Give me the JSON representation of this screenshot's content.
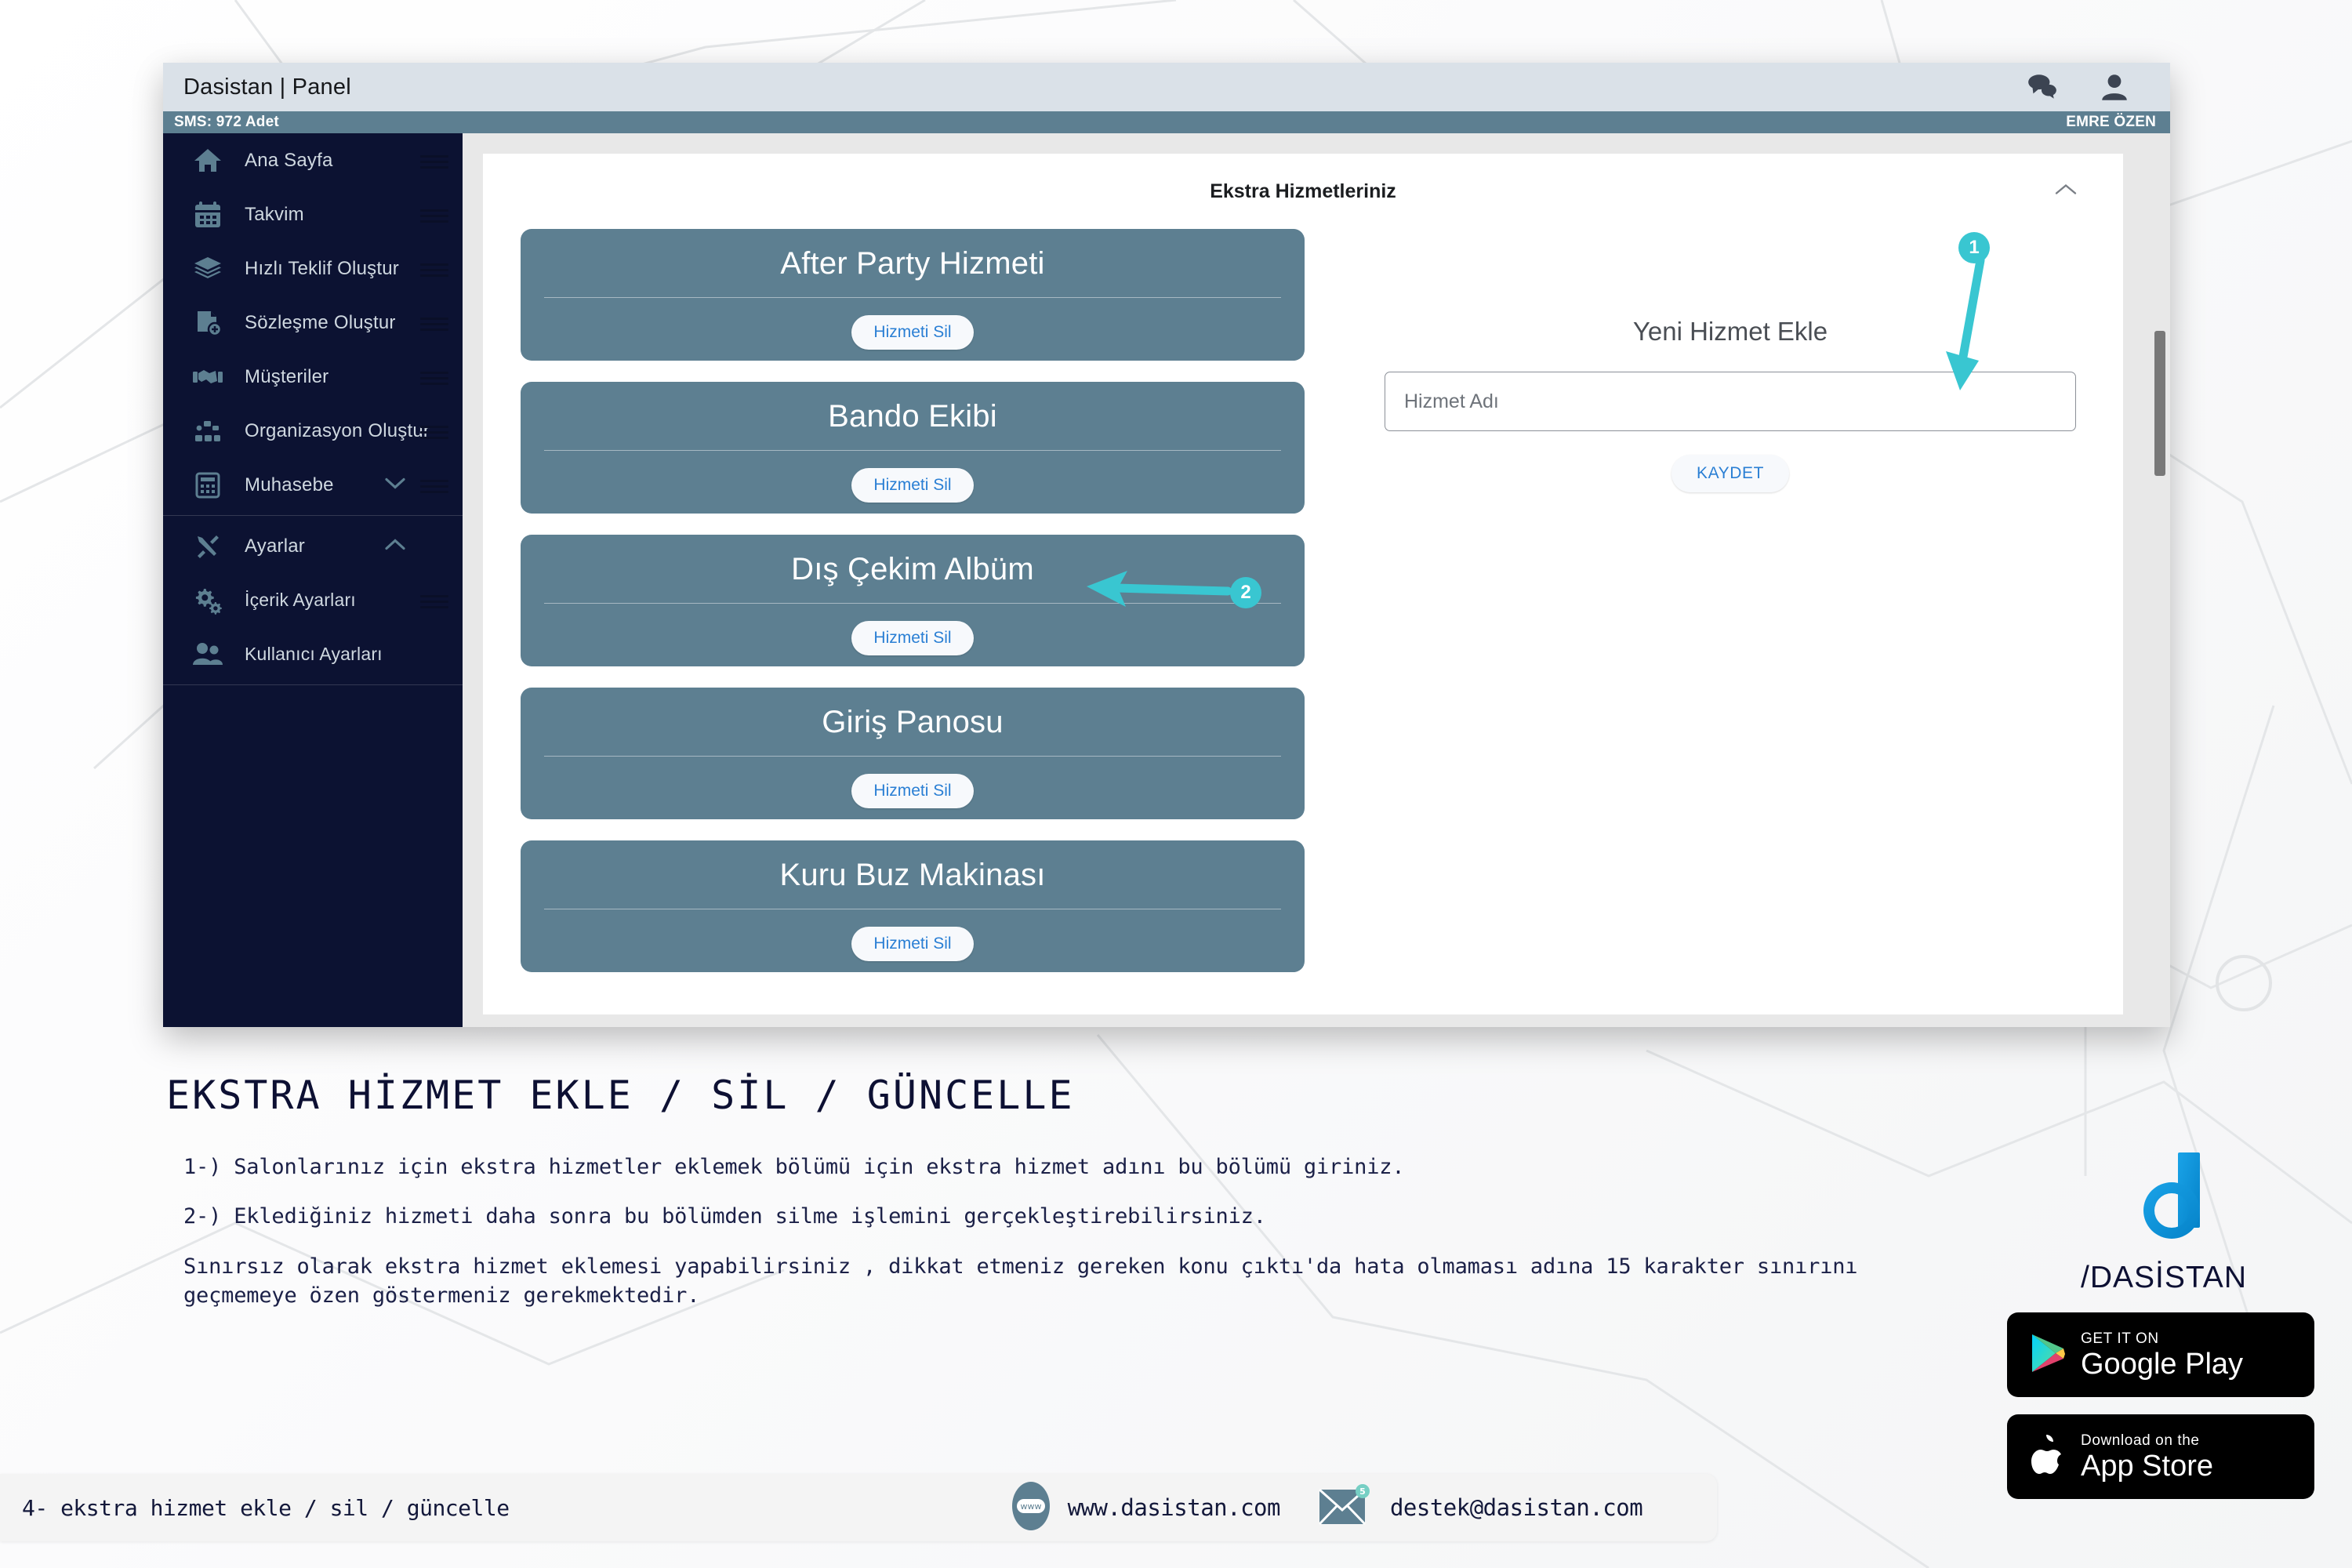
{
  "window": {
    "title": "Dasistan | Panel",
    "topbar_icons": [
      "chat-icon",
      "user-icon"
    ],
    "subbar": {
      "sms": "SMS: 972 Adet",
      "user": "EMRE ÖZEN"
    }
  },
  "sidebar": {
    "items": [
      {
        "label": "Ana Sayfa",
        "icon": "home-icon",
        "expandable": false
      },
      {
        "label": "Takvim",
        "icon": "calendar-icon",
        "expandable": false
      },
      {
        "label": "Hızlı Teklif Oluştur",
        "icon": "layers-icon",
        "expandable": false
      },
      {
        "label": "Sözleşme Oluştur",
        "icon": "document-add-icon",
        "expandable": false
      },
      {
        "label": "Müşteriler",
        "icon": "handshake-icon",
        "expandable": false
      },
      {
        "label": "Organizasyon Oluştur",
        "icon": "sitemap-icon",
        "expandable": false
      },
      {
        "label": "Muhasebe",
        "icon": "calculator-icon",
        "expandable": true
      }
    ],
    "settings_group": [
      {
        "label": "Ayarlar",
        "icon": "tools-icon",
        "expandable": true
      },
      {
        "label": "İçerik Ayarları",
        "icon": "gears-icon",
        "expandable": false
      },
      {
        "label": "Kullanıcı Ayarları",
        "icon": "users-icon",
        "expandable": false
      }
    ]
  },
  "panel": {
    "title": "Ekstra Hizmetleriniz",
    "collapse_icon": "chevron-up-icon",
    "services": [
      {
        "name": "After Party Hizmeti",
        "delete_label": "Hizmeti Sil"
      },
      {
        "name": "Bando Ekibi",
        "delete_label": "Hizmeti Sil"
      },
      {
        "name": "Dış Çekim Albüm",
        "delete_label": "Hizmeti Sil"
      },
      {
        "name": "Giriş Panosu",
        "delete_label": "Hizmeti Sil"
      },
      {
        "name": "Kuru Buz Makinası",
        "delete_label": "Hizmeti Sil"
      }
    ],
    "form": {
      "title": "Yeni Hizmet Ekle",
      "input_placeholder": "Hizmet Adı",
      "input_value": "",
      "save_label": "KAYDET"
    }
  },
  "annotations": [
    {
      "number": "1",
      "target": "hizmet-adi-input"
    },
    {
      "number": "2",
      "target": "hizmeti-sil-button"
    }
  ],
  "explanation": {
    "heading": "EKSTRA HİZMET EKLE / SİL / GÜNCELLE",
    "paragraphs": [
      "1-) Salonlarınız için ekstra hizmetler eklemek bölümü için ekstra hizmet adını bu bölümü giriniz.",
      "2-) Eklediğiniz hizmeti daha sonra bu bölümden silme işlemini gerçekleştirebilirsiniz.",
      "Sınırsız olarak ekstra hizmet eklemesi yapabilirsiniz , dikkat etmeniz gereken konu çıktı'da hata olmaması adına 15 karakter sınırını geçmemeye özen göstermeniz gerekmektedir."
    ]
  },
  "brand": {
    "logo_icon": "dasistan-d-logo",
    "name": "/DASİSTAN",
    "accent_color": "#0b92e0",
    "badges": [
      {
        "icon": "google-play-icon",
        "small": "GET IT ON",
        "big": "Google Play"
      },
      {
        "icon": "apple-icon",
        "small": "Download on the",
        "big": "App Store"
      }
    ]
  },
  "footer": {
    "label": "4- ekstra hizmet ekle / sil / güncelle",
    "website_icon": "www-icon",
    "website": "www.dasistan.com",
    "mail_icon": "envelope-icon",
    "mail_badge": "5",
    "email": "destek@dasistan.com"
  },
  "colors": {
    "sidebar_bg": "#0c1232",
    "card_bg": "#5d7f91",
    "accent_teal": "#39c6d1",
    "link_blue": "#2a7fd4",
    "titlebar": "#dae1e8"
  }
}
